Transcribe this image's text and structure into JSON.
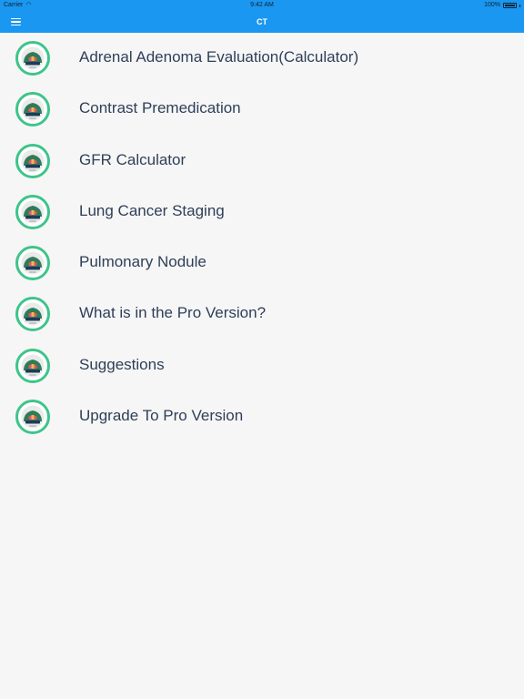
{
  "status_bar": {
    "carrier": "Carrier",
    "time": "9:42 AM",
    "battery": "100%",
    "battery_level": 1.0
  },
  "nav": {
    "title": "CT",
    "menu_icon": "hamburger-menu-icon"
  },
  "colors": {
    "nav_bg": "#1a97f0",
    "avatar_ring": "#3ec48a",
    "text": "#2f3f58",
    "background": "#f6f6f6"
  },
  "list": {
    "item_icon": "app-logo-icon",
    "items": [
      {
        "label": "Adrenal Adenoma Evaluation(Calculator)"
      },
      {
        "label": "Contrast Premedication"
      },
      {
        "label": "GFR Calculator"
      },
      {
        "label": "Lung Cancer Staging"
      },
      {
        "label": "Pulmonary Nodule"
      },
      {
        "label": "What is in the Pro Version?"
      },
      {
        "label": "Suggestions"
      },
      {
        "label": "Upgrade To Pro Version"
      }
    ]
  }
}
